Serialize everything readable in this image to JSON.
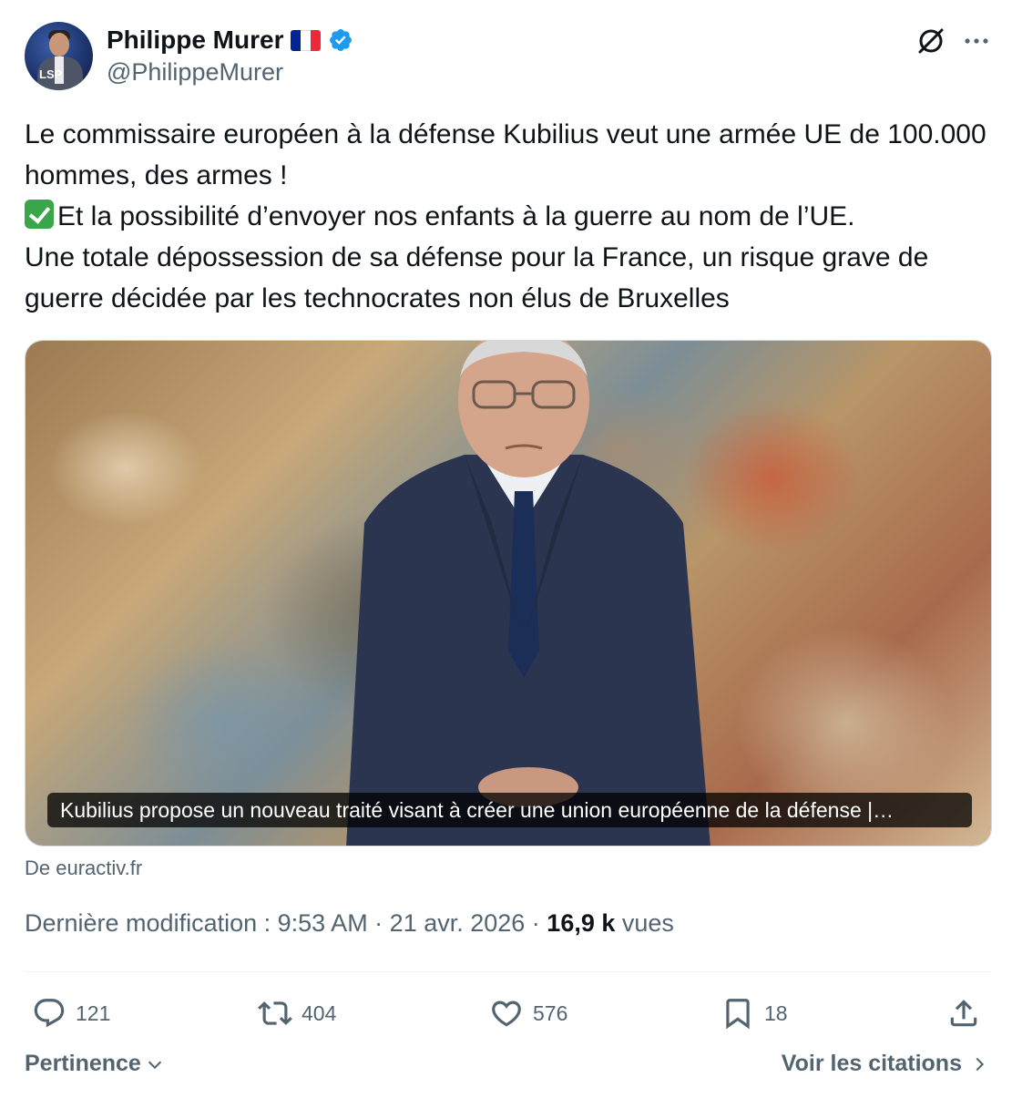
{
  "author": {
    "display_name": "Philippe Murer",
    "handle": "@PhilippeMurer",
    "avatar_logo": "LSP",
    "flag_colors": [
      "#002395",
      "#ffffff",
      "#ed2939"
    ],
    "verified_color": "#1d9bf0"
  },
  "tweet": {
    "line1": "Le commissaire européen à la défense Kubilius veut une armée UE de 100.000 hommes, des armes !",
    "line2": "Et la possibilité d’envoyer nos enfants à la guerre au nom de l’UE.",
    "line3": "Une totale dépossession de sa défense pour la France, un risque grave de guerre décidée par les technocrates non élus de Bruxelles",
    "check_icon": "white-check-mark-emoji"
  },
  "card": {
    "caption": "Kubilius propose un nouveau traité visant à créer une union européenne de la défense |…",
    "source": "De euractiv.fr"
  },
  "meta": {
    "prefix": "Dernière modification : 9:53 AM · 21 avr. 2026 · ",
    "views_count": "16,9 k",
    "views_label": " vues"
  },
  "actions": {
    "replies": "121",
    "retweets": "404",
    "likes": "576",
    "bookmarks": "18"
  },
  "footer": {
    "sort_label": "Pertinence",
    "quotes_label": "Voir les citations"
  },
  "colors": {
    "text_primary": "#0f1419",
    "text_secondary": "#536471",
    "border": "#cfd9de",
    "divider": "#eff3f4"
  }
}
